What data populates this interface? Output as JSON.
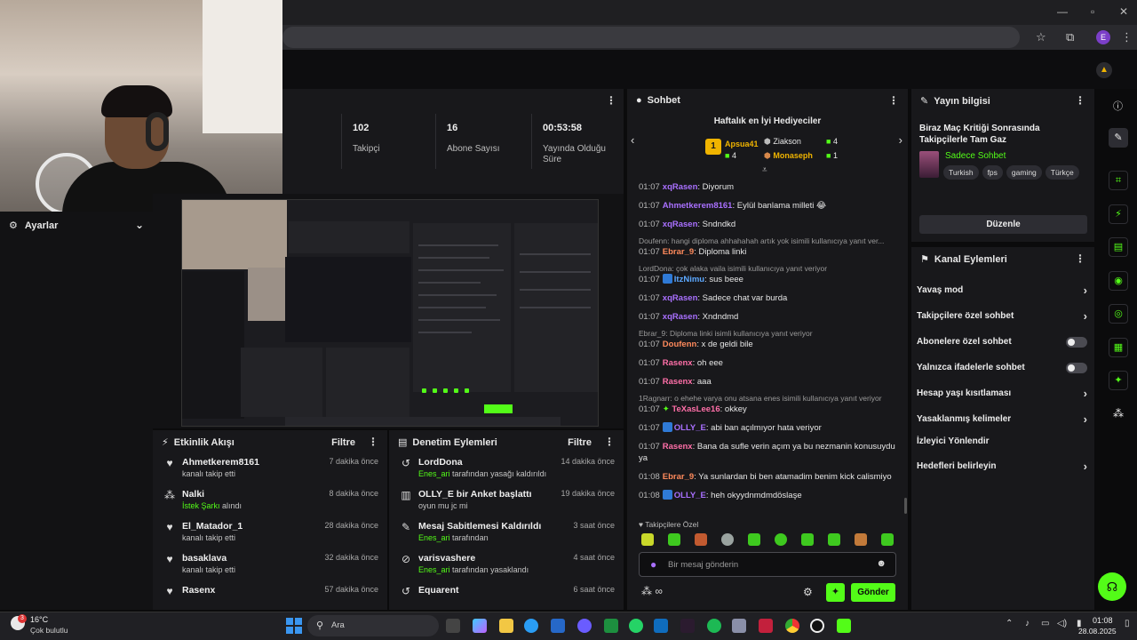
{
  "browser": {
    "avatar_letter": "E"
  },
  "stats": [
    {
      "value": "102",
      "label": "Takipçi"
    },
    {
      "value": "16",
      "label": "Abone Sayısı"
    },
    {
      "value": "00:53:58",
      "label": "Yayında Olduğu Süre"
    }
  ],
  "settings": {
    "title": "Ayarlar"
  },
  "activity": {
    "title": "Etkinlik Akışı",
    "filter": "Filtre",
    "items": [
      {
        "name": "Ahmetkerem8161",
        "desc": "kanalı takip etti",
        "desc_green": "",
        "time": "7 dakika önce",
        "icon": "heart-icon"
      },
      {
        "name": "Nalki",
        "desc": "alındı",
        "desc_green": "İstek Şarkı",
        "time": "8 dakika önce",
        "icon": "kick-points-icon"
      },
      {
        "name": "El_Matador_1",
        "desc": "kanalı takip etti",
        "desc_green": "",
        "time": "28 dakika önce",
        "icon": "heart-icon"
      },
      {
        "name": "basaklava",
        "desc": "kanalı takip etti",
        "desc_green": "",
        "time": "32 dakika önce",
        "icon": "heart-icon"
      },
      {
        "name": "Rasenx",
        "desc": "",
        "desc_green": "",
        "time": "57 dakika önce",
        "icon": "heart-icon"
      }
    ]
  },
  "moderation": {
    "title": "Denetim Eylemleri",
    "filter": "Filtre",
    "items": [
      {
        "name": "LordDona",
        "green": "Enes_ari",
        "desc": "tarafından yasağı kaldırıldı",
        "time": "14 dakika önce",
        "icon": "undo-icon"
      },
      {
        "name": "OLLY_E bir Anket başlattı",
        "green": "",
        "desc": "oyun mu jc mi",
        "time": "19 dakika önce",
        "icon": "poll-icon"
      },
      {
        "name": "Mesaj Sabitlemesi Kaldırıldı",
        "green": "Enes_ari",
        "desc": "tarafından",
        "time": "3 saat önce",
        "icon": "pin-icon"
      },
      {
        "name": "varisvashere",
        "green": "Enes_ari",
        "desc": "tarafından yasaklandı",
        "time": "4 saat önce",
        "icon": "ban-icon"
      },
      {
        "name": "Equarent",
        "green": "",
        "desc": "",
        "time": "6 saat önce",
        "icon": "undo-icon"
      }
    ]
  },
  "chat": {
    "title": "Sohbet",
    "gifters_title": "Haftalık en İyi Hediyeciler",
    "gifters": [
      {
        "rank": "1",
        "name": "Apsua41",
        "count": "4"
      },
      {
        "rank": "2",
        "name": "Ziakson",
        "count": "4"
      },
      {
        "rank": "3",
        "name": "Monaseph",
        "count": "1"
      }
    ],
    "messages": [
      {
        "reply": "",
        "time": "01:07",
        "user": "xqRasen",
        "color": "#a970ff",
        "text": "Diyorum"
      },
      {
        "reply": "",
        "time": "01:07",
        "user": "Ahmetkerem8161",
        "color": "#a970ff",
        "text": "Eylül banlama milleti 😂"
      },
      {
        "reply": "",
        "time": "01:07",
        "user": "xqRasen",
        "color": "#a970ff",
        "text": "Sndndkd"
      },
      {
        "reply": "Doufenn: hangi diploma ahhahahah artık yok isimili kullanıcıya yanıt ver...",
        "time": "01:07",
        "user": "Ebrar_9",
        "color": "#ff8a5c",
        "text": "Diploma linki"
      },
      {
        "reply": "LordDona: çok alaka vaila isimili kullanıcıya yanıt veriyor",
        "time": "01:07",
        "user": "ItzNimu",
        "color": "#5ca8ff",
        "text": "sus beee"
      },
      {
        "reply": "",
        "time": "01:07",
        "user": "xqRasen",
        "color": "#a970ff",
        "text": "Sadece chat var burda"
      },
      {
        "reply": "",
        "time": "01:07",
        "user": "xqRasen",
        "color": "#a970ff",
        "text": "Xndndmd"
      },
      {
        "reply": "Ebrar_9: Diploma linki isimli kullanıcıya yanıt veriyor",
        "time": "01:07",
        "user": "Doufenn",
        "color": "#ff8a5c",
        "text": "x de geldi bile"
      },
      {
        "reply": "",
        "time": "01:07",
        "user": "Rasenx",
        "color": "#ff6fa8",
        "text": "oh eee"
      },
      {
        "reply": "",
        "time": "01:07",
        "user": "Rasenx",
        "color": "#ff6fa8",
        "text": "aaa"
      },
      {
        "reply": "1Ragnarr: o ehehe varya onu atsana enes isimili kullanıcıya yanıt veriyor",
        "time": "01:07",
        "user": "TeXasLee16",
        "color": "#ff6fa8",
        "text": "okkey"
      },
      {
        "reply": "",
        "time": "01:07",
        "user": "OLLY_E",
        "color": "#a970ff",
        "text": "abi ban açılmıyor hata veriyor"
      },
      {
        "reply": "",
        "time": "01:07",
        "user": "Rasenx",
        "color": "#ff6fa8",
        "text": "Bana da sufle verin açım ya bu nezmanin konusuydu ya"
      },
      {
        "reply": "",
        "time": "01:08",
        "user": "Ebrar_9",
        "color": "#ff8a5c",
        "text": "Ya sunlardan bi ben atamadim benim kick calismiyo"
      },
      {
        "reply": "",
        "time": "01:08",
        "user": "OLLY_E",
        "color": "#a970ff",
        "text": "heh okyydnmdmdöslaşe"
      }
    ],
    "followers_only": "Takipçilere Özel",
    "input_placeholder": "Bir mesaj gönderin",
    "send": "Gönder"
  },
  "info": {
    "title": "Yayın bilgisi",
    "stream_title": "Biraz Maç Kritiği Sonrasında Takipçilerle Tam Gaz",
    "category": "Sadece Sohbet",
    "tags": [
      "Turkish",
      "fps",
      "gaming",
      "Türkçe"
    ],
    "edit": "Düzenle"
  },
  "actions": {
    "title": "Kanal Eylemleri",
    "items": [
      {
        "label": "Yavaş mod",
        "kind": "chevron"
      },
      {
        "label": "Takipçilere özel sohbet",
        "kind": "chevron"
      },
      {
        "label": "Abonelere özel sohbet",
        "kind": "toggle"
      },
      {
        "label": "Yalnızca ifadelerle sohbet",
        "kind": "toggle"
      },
      {
        "label": "Hesap yaşı kısıtlaması",
        "kind": "chevron"
      },
      {
        "label": "Yasaklanmış kelimeler",
        "kind": "chevron"
      },
      {
        "label": "İzleyici Yönlendir",
        "kind": "none"
      },
      {
        "label": "Hedefleri belirleyin",
        "kind": "chevron"
      }
    ]
  },
  "taskbar": {
    "weather_temp": "16°C",
    "weather_desc": "Çok bulutlu",
    "search": "Ara",
    "time": "01:08",
    "date": "28.08.2025",
    "notif_count": "3"
  }
}
